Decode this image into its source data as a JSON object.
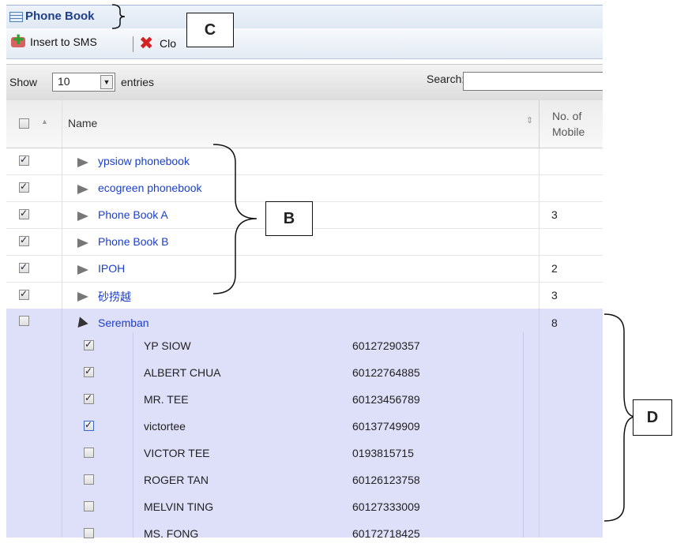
{
  "window": {
    "title": "Phone Book"
  },
  "toolbar": {
    "insert_label": "Insert to SMS",
    "close_label": "Clo"
  },
  "controls": {
    "show_label": "Show",
    "entries_value": "10",
    "entries_label": "entries",
    "search_label": "Search:",
    "search_value": ""
  },
  "table": {
    "col_name": "Name",
    "col_mobile_line1": "No. of",
    "col_mobile_line2": "Mobile",
    "rows": [
      {
        "name": "ypsiow phonebook",
        "count": "",
        "checked": true
      },
      {
        "name": "ecogreen phonebook",
        "count": "",
        "checked": true
      },
      {
        "name": "Phone Book A",
        "count": "3",
        "checked": true
      },
      {
        "name": "Phone Book B",
        "count": "",
        "checked": true
      },
      {
        "name": "IPOH",
        "count": "2",
        "checked": true
      },
      {
        "name": "砂捞越",
        "count": "3",
        "checked": true
      }
    ],
    "expanded": {
      "name": "Seremban",
      "count": "8",
      "checked": false,
      "contacts": [
        {
          "name": "YP SIOW",
          "phone": "60127290357",
          "checked": true
        },
        {
          "name": "ALBERT CHUA",
          "phone": "60122764885",
          "checked": true
        },
        {
          "name": "MR. TEE",
          "phone": "60123456789",
          "checked": true
        },
        {
          "name": "victortee",
          "phone": "60137749909",
          "checked": true
        },
        {
          "name": "VICTOR TEE",
          "phone": "0193815715",
          "checked": false
        },
        {
          "name": "ROGER TAN",
          "phone": "60126123758",
          "checked": false
        },
        {
          "name": "MELVIN TING",
          "phone": "60127333009",
          "checked": false
        },
        {
          "name": "MS. FONG",
          "phone": "60172718425",
          "checked": false
        }
      ]
    }
  },
  "annotations": {
    "c": "C",
    "b": "B",
    "d": "D"
  },
  "icons": {
    "title": "phonebook-icon",
    "insert": "insert-sms-icon",
    "close": "close-icon",
    "sort": "sort-icon",
    "row_expand": "expand-arrow-icon",
    "row_collapse": "collapse-arrow-icon"
  }
}
